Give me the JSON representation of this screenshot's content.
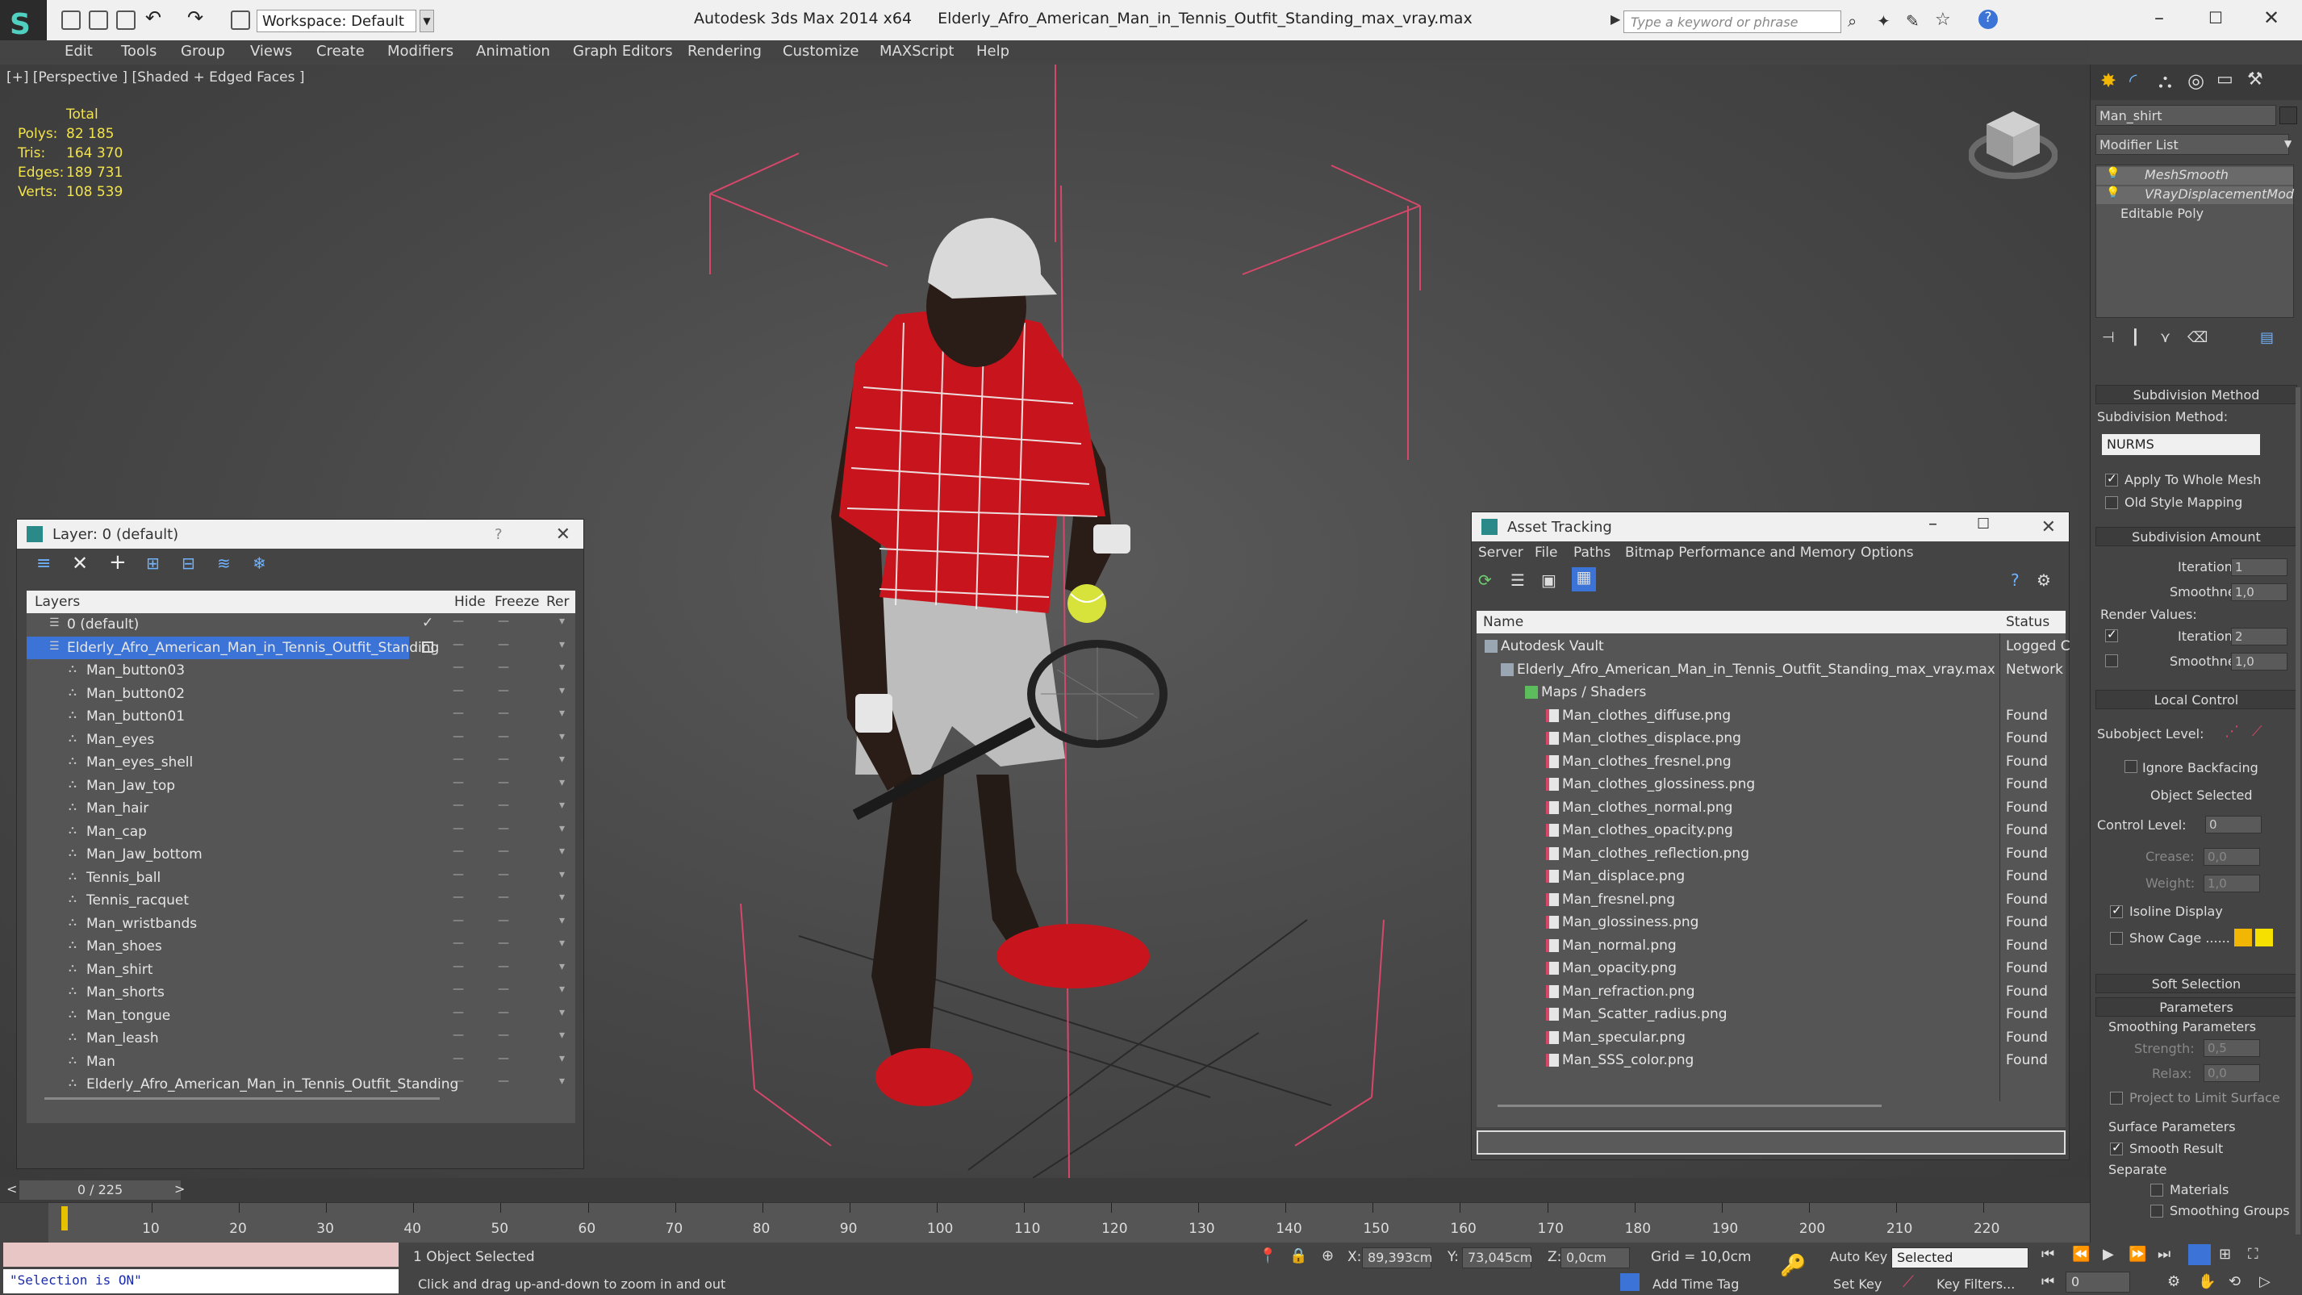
{
  "app": {
    "title": "Autodesk 3ds Max  2014 x64",
    "file": "Elderly_Afro_American_Man_in_Tennis_Outfit_Standing_max_vray.max",
    "workspace": "Workspace: Default",
    "search_placeholder": "Type a keyword or phrase"
  },
  "menu": [
    "Edit",
    "Tools",
    "Group",
    "Views",
    "Create",
    "Modifiers",
    "Animation",
    "Graph Editors",
    "Rendering",
    "Customize",
    "MAXScript",
    "Help"
  ],
  "viewport": {
    "label": "[+] [Perspective ] [Shaded + Edged Faces ]",
    "stats": {
      "header": "Total",
      "rows": [
        {
          "k": "Polys:",
          "v": "82 185"
        },
        {
          "k": "Tris:",
          "v": "164 370"
        },
        {
          "k": "Edges:",
          "v": "189 731"
        },
        {
          "k": "Verts:",
          "v": "108 539"
        }
      ]
    }
  },
  "layer_panel": {
    "title": "Layer: 0 (default)",
    "help": "?",
    "columns": [
      "Layers",
      "Hide",
      "Freeze",
      "Rer"
    ],
    "rows": [
      "0 (default)",
      "Elderly_Afro_American_Man_in_Tennis_Outfit_Standing",
      "Man_button03",
      "Man_button02",
      "Man_button01",
      "Man_eyes",
      "Man_eyes_shell",
      "Man_Jaw_top",
      "Man_hair",
      "Man_cap",
      "Man_Jaw_bottom",
      "Tennis_ball",
      "Tennis_racquet",
      "Man_wristbands",
      "Man_shoes",
      "Man_shirt",
      "Man_shorts",
      "Man_tongue",
      "Man_leash",
      "Man",
      "Elderly_Afro_American_Man_in_Tennis_Outfit_Standing"
    ]
  },
  "asset_panel": {
    "title": "Asset Tracking",
    "menu": [
      "Server",
      "File",
      "Paths",
      "Bitmap Performance and Memory",
      "Options"
    ],
    "columns": [
      "Name",
      "Status"
    ],
    "rows": [
      {
        "name": "Autodesk Vault",
        "status": "Logged C",
        "indent": 0
      },
      {
        "name": "Elderly_Afro_American_Man_in_Tennis_Outfit_Standing_max_vray.max",
        "status": "Network",
        "indent": 1
      },
      {
        "name": "Maps / Shaders",
        "status": "",
        "indent": 2
      },
      {
        "name": "Man_clothes_diffuse.png",
        "status": "Found",
        "indent": 3
      },
      {
        "name": "Man_clothes_displace.png",
        "status": "Found",
        "indent": 3
      },
      {
        "name": "Man_clothes_fresnel.png",
        "status": "Found",
        "indent": 3
      },
      {
        "name": "Man_clothes_glossiness.png",
        "status": "Found",
        "indent": 3
      },
      {
        "name": "Man_clothes_normal.png",
        "status": "Found",
        "indent": 3
      },
      {
        "name": "Man_clothes_opacity.png",
        "status": "Found",
        "indent": 3
      },
      {
        "name": "Man_clothes_reflection.png",
        "status": "Found",
        "indent": 3
      },
      {
        "name": "Man_displace.png",
        "status": "Found",
        "indent": 3
      },
      {
        "name": "Man_fresnel.png",
        "status": "Found",
        "indent": 3
      },
      {
        "name": "Man_glossiness.png",
        "status": "Found",
        "indent": 3
      },
      {
        "name": "Man_normal.png",
        "status": "Found",
        "indent": 3
      },
      {
        "name": "Man_opacity.png",
        "status": "Found",
        "indent": 3
      },
      {
        "name": "Man_refraction.png",
        "status": "Found",
        "indent": 3
      },
      {
        "name": "Man_Scatter_radius.png",
        "status": "Found",
        "indent": 3
      },
      {
        "name": "Man_specular.png",
        "status": "Found",
        "indent": 3
      },
      {
        "name": "Man_SSS_color.png",
        "status": "Found",
        "indent": 3
      }
    ]
  },
  "command_panel": {
    "object_name": "Man_shirt",
    "modifier_list": "Modifier List",
    "stack": [
      "MeshSmooth",
      "VRayDisplacementMod",
      "Editable Poly"
    ],
    "subdivision_method_hdr": "Subdivision Method",
    "subdivision_method_label": "Subdivision Method:",
    "subdivision_method_value": "NURMS",
    "apply_whole_mesh": "Apply To Whole Mesh",
    "old_style_mapping": "Old Style Mapping",
    "subdivision_amount_hdr": "Subdivision Amount",
    "iterations_label": "Iterations:",
    "iterations_value": "1",
    "smoothness_label": "Smoothness:",
    "smoothness_value": "1,0",
    "render_values_label": "Render Values:",
    "render_iterations_value": "2",
    "render_smoothness_value": "1,0",
    "local_control_hdr": "Local Control",
    "subobject_level": "Subobject Level:",
    "ignore_backfacing": "Ignore Backfacing",
    "object_selected": "Object Selected",
    "control_level_label": "Control Level:",
    "control_level_value": "0",
    "crease_label": "Crease:",
    "crease_value": "0,0",
    "weight_label": "Weight:",
    "weight_value": "1,0",
    "isoline_display": "Isoline Display",
    "show_cage": "Show Cage ......",
    "soft_selection_hdr": "Soft Selection",
    "parameters_hdr": "Parameters",
    "smoothing_params": "Smoothing Parameters",
    "strength_label": "Strength:",
    "strength_value": "0,5",
    "relax_label": "Relax:",
    "relax_value": "0,0",
    "project_limit": "Project to Limit Surface",
    "surface_params": "Surface Parameters",
    "smooth_result": "Smooth Result",
    "separate": "Separate",
    "materials": "Materials",
    "smoothing_groups": "Smoothing Groups",
    "cage_color_1": "#f2b705",
    "cage_color_2": "#f5e000"
  },
  "timeline": {
    "frame": "0 / 225",
    "ticks": [
      "10",
      "20",
      "30",
      "40",
      "50",
      "60",
      "70",
      "80",
      "90",
      "100",
      "110",
      "120",
      "130",
      "140",
      "150",
      "160",
      "170",
      "180",
      "190",
      "200",
      "210",
      "220"
    ]
  },
  "status": {
    "maxscript": "\"Selection is ON\"",
    "selected": "1 Object Selected",
    "prompt": "Click and drag up-and-down to zoom in and out",
    "x_label": "X:",
    "x_value": "89,393cm",
    "y_label": "Y:",
    "y_value": "73,045cm",
    "z_label": "Z:",
    "z_value": "0,0cm",
    "grid": "Grid = 10,0cm",
    "add_time_tag": "Add Time Tag",
    "auto_key": "Auto Key",
    "set_key": "Set Key",
    "selected_filter": "Selected",
    "key_filters": "Key Filters...",
    "current_frame": "0"
  },
  "colors": {
    "accent": "#3b73d6",
    "shirt": "#c8151d",
    "bounds": "#d6476a",
    "stats": "#f2e34c"
  }
}
